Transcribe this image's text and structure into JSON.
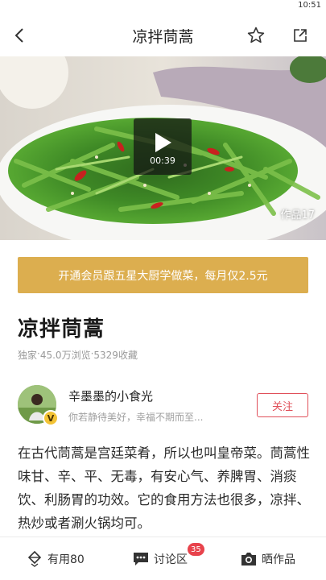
{
  "status_bar": {
    "time": "10:51"
  },
  "nav": {
    "title": "凉拌茼蒿"
  },
  "video": {
    "duration": "00:39",
    "works_label": "作品17"
  },
  "vip_banner": {
    "text": "开通会员跟五星大厨学做菜，每月仅2.5元"
  },
  "recipe": {
    "title": "凉拌茼蒿",
    "meta": [
      "独家",
      "45.0万浏览",
      "5329收藏"
    ],
    "meta_separator": " · "
  },
  "author": {
    "name": "辛墨墨的小食光",
    "bio": "你若静待美好，幸福不期而至...",
    "badge": "V",
    "follow_label": "关注"
  },
  "description": "在古代茼蒿是宫廷菜肴，所以也叫皇帝菜。茼蒿性味甘、辛、平、无毒，有安心气、养脾胃、消痰饮、利肠胃的功效。它的食用方法也很多，凉拌、热炒或者涮火锅均可。",
  "bottom_bar": {
    "useful_label": "有用80",
    "comment_label": "讨论区",
    "comment_count": "35",
    "share_label": "晒作品"
  },
  "colors": {
    "vip_gold": "#dcae4f",
    "follow_red": "#e0505a",
    "badge_red": "#e8434c"
  },
  "icons": {
    "back": "back-arrow-icon",
    "favorite": "star-icon",
    "share": "share-icon",
    "play": "play-icon",
    "useful": "diamond-icon",
    "comment": "comment-icon",
    "camera": "camera-icon"
  }
}
